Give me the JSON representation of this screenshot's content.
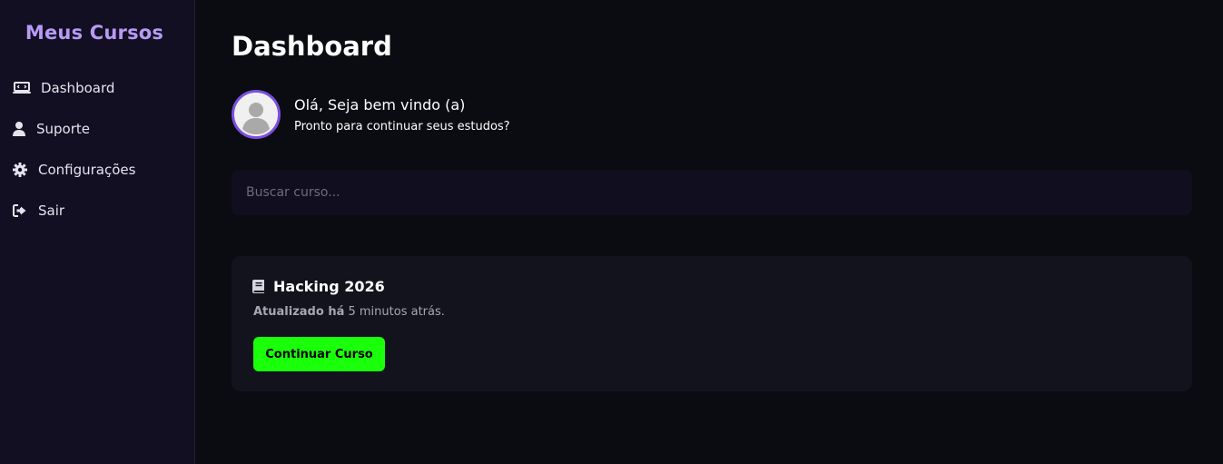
{
  "sidebar": {
    "brand": "Meus Cursos",
    "items": [
      {
        "label": "Dashboard",
        "icon": "dashboard-icon"
      },
      {
        "label": "Suporte",
        "icon": "user-icon"
      },
      {
        "label": "Configurações",
        "icon": "gear-icon"
      },
      {
        "label": "Sair",
        "icon": "logout-icon"
      }
    ]
  },
  "main": {
    "title": "Dashboard",
    "welcome": {
      "greeting": "Olá, Seja bem vindo (a)",
      "subtitle": "Pronto para continuar seus estudos?",
      "avatar_icon": "avatar-placeholder-icon"
    },
    "search": {
      "placeholder": "Buscar curso...",
      "value": ""
    },
    "course": {
      "title": "Hacking 2026",
      "icon": "book-icon",
      "updated_label": "Atualizado há",
      "updated_value": "5 minutos atrás.",
      "button_label": "Continuar Curso"
    }
  },
  "colors": {
    "brand": "#b79af5",
    "accent_button": "#1aff0a",
    "avatar_border": "#7b4fe0",
    "sidebar_bg": "#120f22",
    "main_bg": "#0b0b12",
    "card_bg": "#13131e"
  }
}
